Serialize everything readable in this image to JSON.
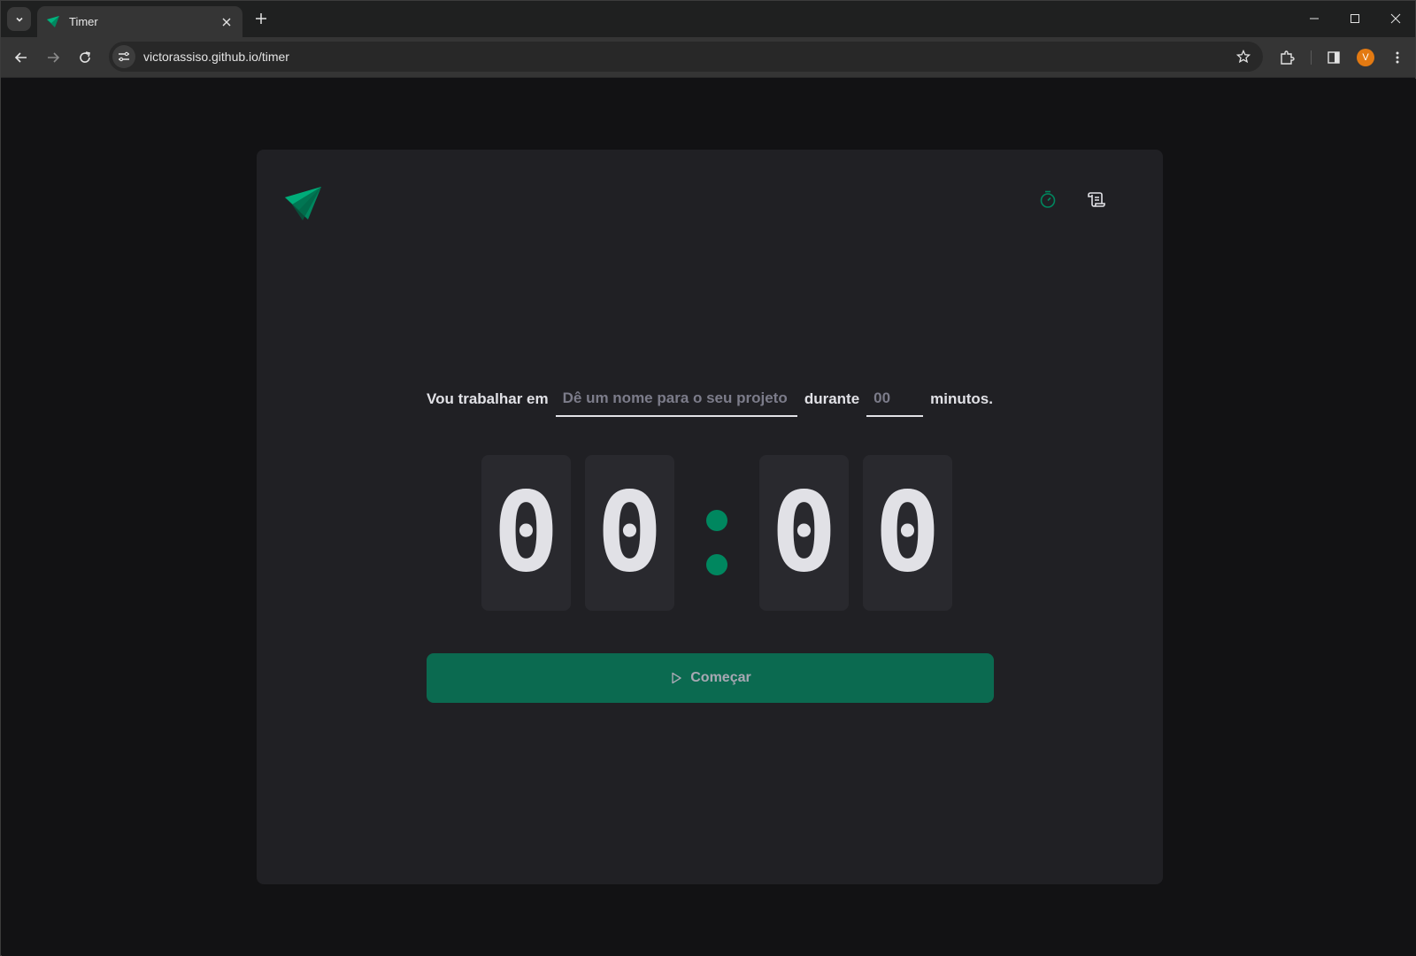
{
  "browser": {
    "tab_title": "Timer",
    "url": "victorassiso.github.io/timer",
    "avatar_letter": "V",
    "accent": "#e37a12"
  },
  "header": {
    "logo": "ignite-triangle-logo",
    "nav": [
      {
        "name": "timer",
        "icon": "timer-icon",
        "active": true
      },
      {
        "name": "history",
        "icon": "scroll-icon",
        "active": false
      }
    ]
  },
  "form": {
    "task_label": "Vou trabalhar em",
    "task_placeholder": "Dê um nome para o seu projeto",
    "task_value": "",
    "duration_label": "durante",
    "minutes_placeholder": "00",
    "minutes_value": "",
    "minutes_suffix": "minutos."
  },
  "countdown": {
    "minutes": [
      "0",
      "0"
    ],
    "seconds": [
      "0",
      "0"
    ]
  },
  "start_button": {
    "label": "Começar",
    "icon": "play-icon"
  },
  "colors": {
    "brand_green": "#00875f",
    "button_green": "#0b6a50",
    "card_bg": "#202024",
    "page_bg": "#121214",
    "digit_bg": "#29292e",
    "text": "#e1e1e6"
  }
}
